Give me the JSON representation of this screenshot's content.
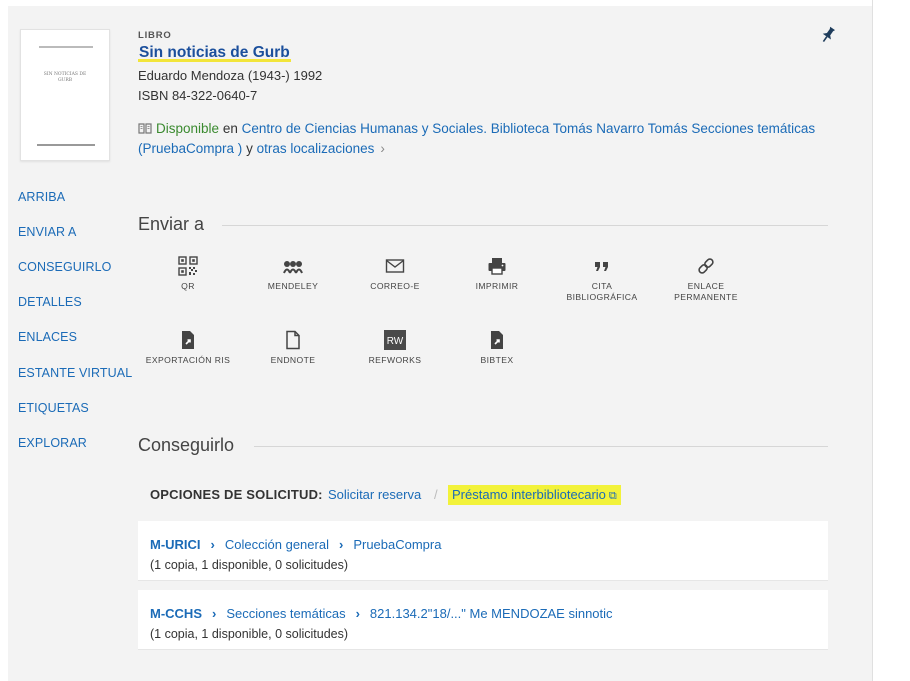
{
  "record": {
    "type": "LIBRO",
    "title": "Sin noticias de Gurb",
    "author": "Eduardo Mendoza (1943-) 1992",
    "isbn": "ISBN 84-322-0640-7",
    "cover_text": "SIN NOTICIAS DE GURB",
    "availability": {
      "status": "Disponible",
      "en": "en",
      "location": "Centro de Ciencias Humanas y Sociales. Biblioteca Tomás Navarro Tomás  Secciones temáticas (PruebaCompra )",
      "y": "y",
      "others": "otras localizaciones"
    }
  },
  "sidenav": {
    "items": [
      "ARRIBA",
      "ENVIAR A",
      "CONSEGUIRLO",
      "DETALLES",
      "ENLACES",
      "ESTANTE VIRTUAL",
      "ETIQUETAS",
      "EXPLORAR"
    ]
  },
  "send_to": {
    "title": "Enviar a",
    "row1": [
      {
        "label": "QR",
        "icon": "qr-code-icon"
      },
      {
        "label": "MENDELEY",
        "icon": "mendeley-icon"
      },
      {
        "label": "CORREO-E",
        "icon": "envelope-icon"
      },
      {
        "label": "IMPRIMIR",
        "icon": "printer-icon"
      },
      {
        "label": "CITA BIBLIOGRÁFICA",
        "icon": "quote-icon"
      },
      {
        "label": "ENLACE PERMANENTE",
        "icon": "link-icon"
      }
    ],
    "row2": [
      {
        "label": "EXPORTACIÓN RIS",
        "icon": "file-export-icon"
      },
      {
        "label": "ENDNOTE",
        "icon": "file-icon"
      },
      {
        "label": "REFWORKS",
        "icon": "refworks-icon",
        "badge": "RW"
      },
      {
        "label": "BIBTEX",
        "icon": "file-export-icon"
      }
    ]
  },
  "get_it": {
    "title": "Conseguirlo",
    "request_label": "OPCIONES DE SOLICITUD:",
    "request_hold": "Solicitar reserva",
    "separator": "/",
    "request_ill": "Préstamo interbibliotecario",
    "locations": [
      {
        "library": "M-URICI",
        "collection": "Colección general",
        "call": "PruebaCompra",
        "items": "(1 copia, 1 disponible, 0 solicitudes)"
      },
      {
        "library": "M-CCHS",
        "collection": "Secciones temáticas",
        "call": "821.134.2\"18/...\" Me MENDOZAE sinnotic",
        "items": "(1 copia, 1 disponible, 0 solicitudes)"
      }
    ]
  },
  "colors": {
    "link": "#1b6bb7",
    "title": "#1b4f9c",
    "available": "#3a8a2f",
    "highlight": "#f2f23a",
    "icon": "#444444",
    "panel_bg": "#f3f3f3"
  }
}
